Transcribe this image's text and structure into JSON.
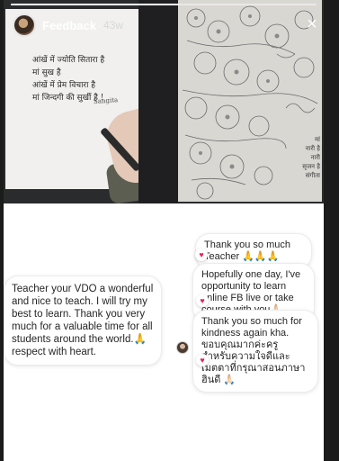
{
  "story": {
    "progress_fraction": 0.55,
    "handle": "Feedback",
    "age": "43w",
    "close_label": "×"
  },
  "photo": {
    "left_page_lines": [
      "आंखें में ज्योति सितारा है",
      "मां सुख है",
      "आंखें में प्रेम विचारा है",
      "मां जिन्दगी की सुर्खी है !"
    ],
    "left_signature": "Sangita",
    "right_page_lines": [
      "मां",
      "नारी है",
      "नारी",
      "सृजन है",
      "संगीता"
    ]
  },
  "chat": {
    "incoming": {
      "text": "Teacher your VDO a wonderful and nice to teach. I will try my best to learn. Thank you very much for a valuable time for all students around the world.🙏 respect with heart."
    },
    "replies": [
      {
        "text": "Thank you so much Teacher 🙏🙏🙏"
      },
      {
        "text": "Hopefully one day, I've opportunity to learn online FB live or take course with you🙏🏻"
      },
      {
        "text": "Thank you so much for kindness again kha. ขอบคุณมากค่ะครู สำหรับความใจดีและเมตตาที่กรุณาสอนภาษาฮินดี 🙏🏻"
      }
    ],
    "heart_icon": "♥"
  },
  "colors": {
    "heart": "#e0245e",
    "bubble_border": "#ececec"
  }
}
